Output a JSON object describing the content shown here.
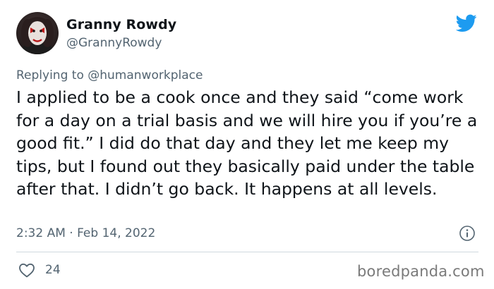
{
  "author": {
    "display_name": "Granny Rowdy",
    "handle": "@GrannyRowdy",
    "avatar_icon": "avatar-clown-makeup"
  },
  "platform": {
    "icon": "twitter-bird-icon",
    "color": "#1d9bf0"
  },
  "reply": {
    "prefix": "Replying to ",
    "mention": "@humanworkplace"
  },
  "tweet": {
    "text": "I applied to be a cook once and they said “come work for a day on a trial basis and we will hire you if you’re a good fit.” I did do that day and they let me keep my tips, but I found out they basically paid under the table after that. I didn’t go back. It happens at all levels.",
    "timestamp": "2:32 AM · Feb 14, 2022"
  },
  "engagement": {
    "likes": "24",
    "like_icon": "heart-icon",
    "info_icon": "info-icon"
  },
  "watermark": "boredpanda.com",
  "colors": {
    "text": "#0f1419",
    "secondary": "#536471",
    "divider": "#cfd9de"
  }
}
